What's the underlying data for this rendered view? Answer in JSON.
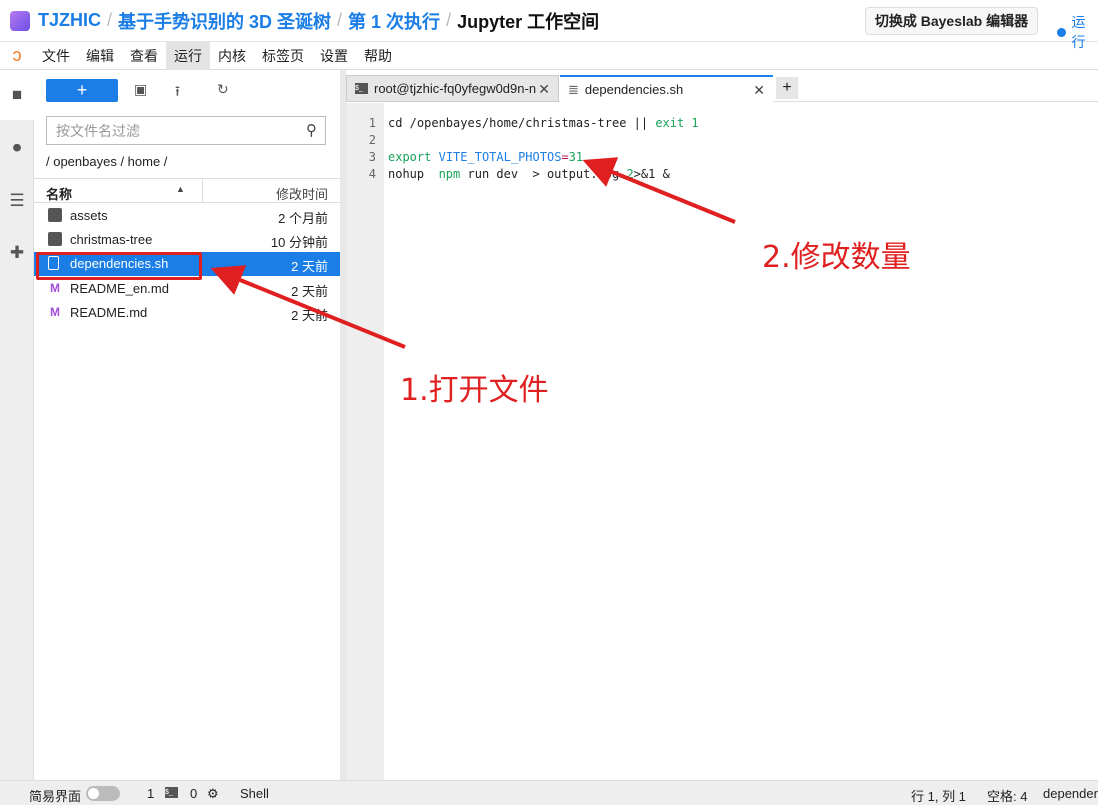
{
  "header": {
    "breadcrumbs": [
      "TJZHIC",
      "基于手势识别的 3D 圣诞树",
      "第 1 次执行",
      "Jupyter 工作空间"
    ],
    "switch_button": "切换成 Bayeslab 编辑器",
    "run_status": "运行"
  },
  "menu": [
    "文件",
    "编辑",
    "查看",
    "运行",
    "内核",
    "标签页",
    "设置",
    "帮助"
  ],
  "browser": {
    "new_label": "+",
    "filter_placeholder": "按文件名过滤",
    "path": "/ openbayes / home /",
    "col_name": "名称",
    "col_modified": "修改时间",
    "files": [
      {
        "name": "assets",
        "time": "2 个月前",
        "type": "folder"
      },
      {
        "name": "christmas-tree",
        "time": "10 分钟前",
        "type": "folder"
      },
      {
        "name": "dependencies.sh",
        "time": "2 天前",
        "type": "file",
        "selected": true
      },
      {
        "name": "README_en.md",
        "time": "2 天前",
        "type": "markdown"
      },
      {
        "name": "README.md",
        "time": "2 天前",
        "type": "markdown"
      }
    ]
  },
  "tabs": [
    {
      "label": "root@tjzhic-fq0yfegw0d9n-n"
    },
    {
      "label": "dependencies.sh"
    }
  ],
  "editor": {
    "line_numbers": [
      "1",
      "2",
      "3",
      "4"
    ],
    "l1a": "cd /openbayes/home/christmas-tree || ",
    "l1b": "exit 1",
    "l3a": "export",
    "l3b": "VITE_TOTAL_PHOTOS",
    "l3c": "=",
    "l3d": "31",
    "l4a": "nohup  ",
    "l4b": "npm",
    "l4c": " run dev  > output.log ",
    "l4d": "2",
    ">l4e": "",
    "l4e": ">&1 &"
  },
  "status": {
    "simple_mode": "简易界面",
    "terminals": "1",
    "kernels": "0",
    "shell": "Shell",
    "cursor": "行 1, 列 1",
    "spaces": "空格: 4",
    "file": "dependencies.sh"
  },
  "annotations": {
    "step1": "1.打开文件",
    "step2": "2.修改数量",
    "color": "#e02020"
  },
  "colors": {
    "accent": "#1a7ee6",
    "annotation": "#e02020"
  }
}
